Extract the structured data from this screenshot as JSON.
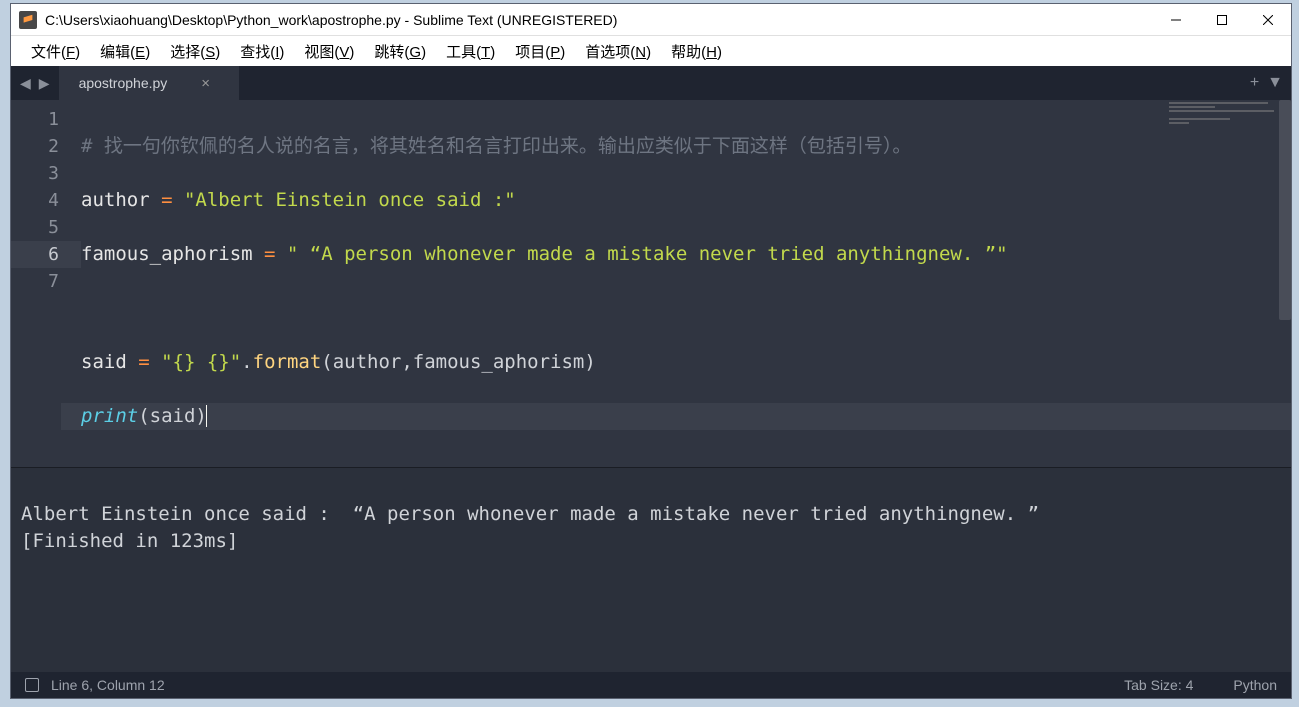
{
  "window": {
    "title": "C:\\Users\\xiaohuang\\Desktop\\Python_work\\apostrophe.py - Sublime Text (UNREGISTERED)"
  },
  "menu": {
    "file": {
      "label": "文件(",
      "key": "F",
      "suffix": ")"
    },
    "edit": {
      "label": "编辑(",
      "key": "E",
      "suffix": ")"
    },
    "select": {
      "label": "选择(",
      "key": "S",
      "suffix": ")"
    },
    "find": {
      "label": "查找(",
      "key": "I",
      "suffix": ")"
    },
    "view": {
      "label": "视图(",
      "key": "V",
      "suffix": ")"
    },
    "goto": {
      "label": "跳转(",
      "key": "G",
      "suffix": ")"
    },
    "tools": {
      "label": "工具(",
      "key": "T",
      "suffix": ")"
    },
    "project": {
      "label": "项目(",
      "key": "P",
      "suffix": ")"
    },
    "prefs": {
      "label": "首选项(",
      "key": "N",
      "suffix": ")"
    },
    "help": {
      "label": "帮助(",
      "key": "H",
      "suffix": ")"
    }
  },
  "tab": {
    "name": "apostrophe.py"
  },
  "code": {
    "l1_comment": "# 找一句你钦佩的名人说的名言，将其姓名和名言打印出来。输出应类似于下面这样（包括引号）。",
    "l2_var": "author",
    "l2_eq": " = ",
    "l2_str": "\"Albert Einstein once said :\"",
    "l3_var": "famous_aphorism",
    "l3_eq": " = ",
    "l3_str": "\" “A person whonever made a mistake never tried anythingnew. ”\"",
    "l5_var": "said",
    "l5_eq": " = ",
    "l5_str": "\"{} {}\"",
    "l5_dot": ".",
    "l5_fmt": "format",
    "l5_arg": "(author,famous_aphorism)",
    "l6_print": "print",
    "l6_arg": "(said)"
  },
  "lines": [
    "1",
    "2",
    "3",
    "4",
    "5",
    "6",
    "7"
  ],
  "active_line": "6",
  "output": {
    "line1": "Albert Einstein once said :  “A person whonever made a mistake never tried anythingnew. ”",
    "line2": "[Finished in 123ms]"
  },
  "status": {
    "position": "Line 6, Column 12",
    "tabsize": "Tab Size: 4",
    "syntax": "Python"
  }
}
